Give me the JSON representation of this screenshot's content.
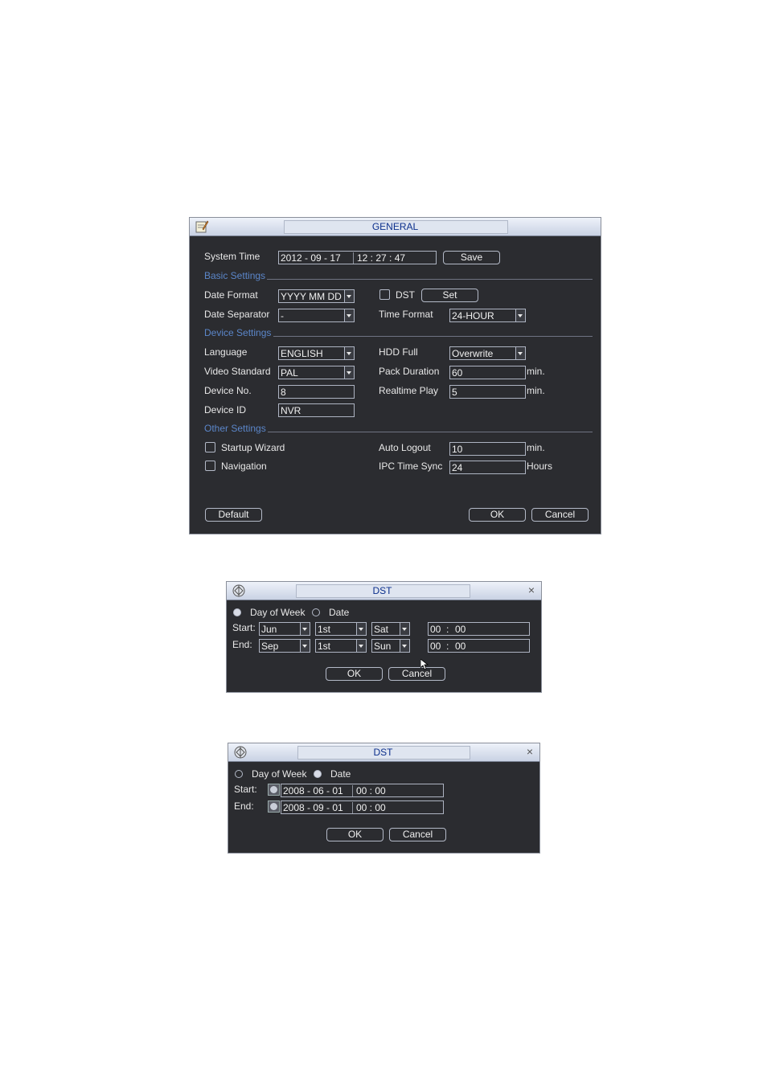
{
  "general": {
    "title": "GENERAL",
    "system_time_label": "System Time",
    "system_date": "2012  - 09 - 17",
    "system_clock": "12 : 27 : 47",
    "save_label": "Save",
    "basic_settings": "Basic Settings",
    "date_format_label": "Date Format",
    "date_format_value": "YYYY MM DD",
    "dst_label": "DST",
    "set_label": "Set",
    "date_separator_label": "Date Separator",
    "date_separator_value": "-",
    "time_format_label": "Time Format",
    "time_format_value": "24-HOUR",
    "device_settings": "Device Settings",
    "language_label": "Language",
    "language_value": "ENGLISH",
    "hdd_full_label": "HDD Full",
    "hdd_full_value": "Overwrite",
    "video_standard_label": "Video Standard",
    "video_standard_value": "PAL",
    "pack_duration_label": "Pack Duration",
    "pack_duration_value": "60",
    "min_unit": "min.",
    "device_no_label": "Device No.",
    "device_no_value": "8",
    "realtime_play_label": "Realtime Play",
    "realtime_play_value": "5",
    "device_id_label": "Device ID",
    "device_id_value": "NVR",
    "other_settings": "Other Settings",
    "startup_wizard_label": "Startup Wizard",
    "auto_logout_label": "Auto Logout",
    "auto_logout_value": "10",
    "navigation_label": "Navigation",
    "ipc_time_sync_label": "IPC Time Sync",
    "ipc_time_sync_value": "24",
    "hours_unit": "Hours",
    "default_label": "Default",
    "ok_label": "OK",
    "cancel_label": "Cancel"
  },
  "dst_week": {
    "title": "DST",
    "day_of_week_label": "Day of Week",
    "date_label": "Date",
    "start_label": "Start:",
    "end_label": "End:",
    "start_month": "Jun",
    "start_week": "1st",
    "start_day": "Sat",
    "start_time_h": "00",
    "start_time_m": "00",
    "end_month": "Sep",
    "end_week": "1st",
    "end_day": "Sun",
    "end_time_h": "00",
    "end_time_m": "00",
    "ok_label": "OK",
    "cancel_label": "Cancel"
  },
  "dst_date": {
    "title": "DST",
    "day_of_week_label": "Day of Week",
    "date_label": "Date",
    "start_label": "Start:",
    "end_label": "End:",
    "start_date": "2008  - 06 - 01",
    "start_time": "00 : 00",
    "end_date": "2008  - 09 - 01",
    "end_time": "00 : 00",
    "ok_label": "OK",
    "cancel_label": "Cancel"
  }
}
